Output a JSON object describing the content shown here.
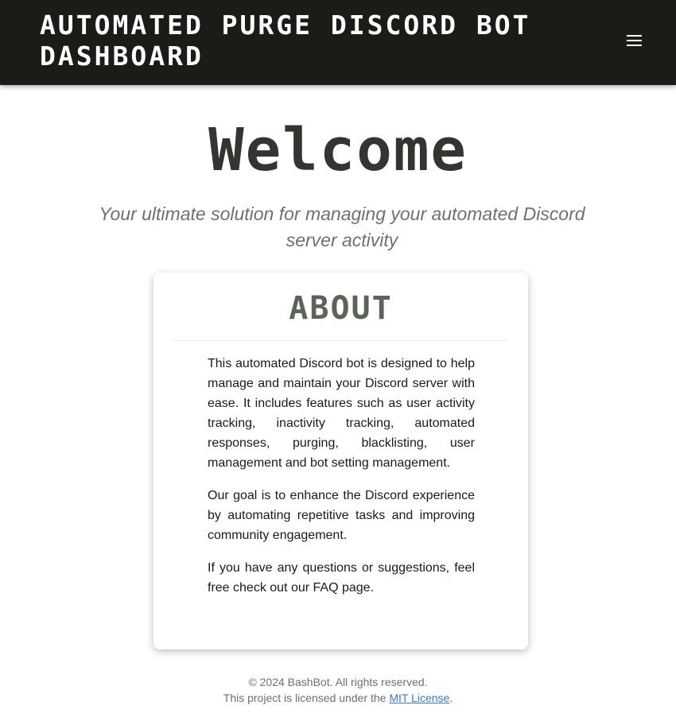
{
  "header": {
    "title": "Automated Purge Discord Bot Dashboard",
    "menu_icon": "hamburger-menu-icon"
  },
  "hero": {
    "heading": "Welcome",
    "tagline": "Your ultimate solution for managing your automated Discord server activity"
  },
  "about": {
    "title": "About",
    "paragraphs": [
      "This automated Discord bot is designed to help manage and maintain your Discord server with ease. It includes features such as user activity tracking, inactivity tracking, automated responses, purging, blacklisting, user management and bot setting management.",
      "Our goal is to enhance the Discord experience by automating repetitive tasks and improving community engagement.",
      "If you have any questions or suggestions, feel free check out our FAQ page."
    ]
  },
  "footer": {
    "copyright": "© 2024 BashBot. All rights reserved.",
    "license_prefix": "This project is licensed under the ",
    "license_link": "MIT License",
    "license_suffix": "."
  },
  "colors": {
    "header_bg": "#1b1b17",
    "heading": "#333530",
    "muted": "#6c7075",
    "link": "#3b78c8"
  }
}
